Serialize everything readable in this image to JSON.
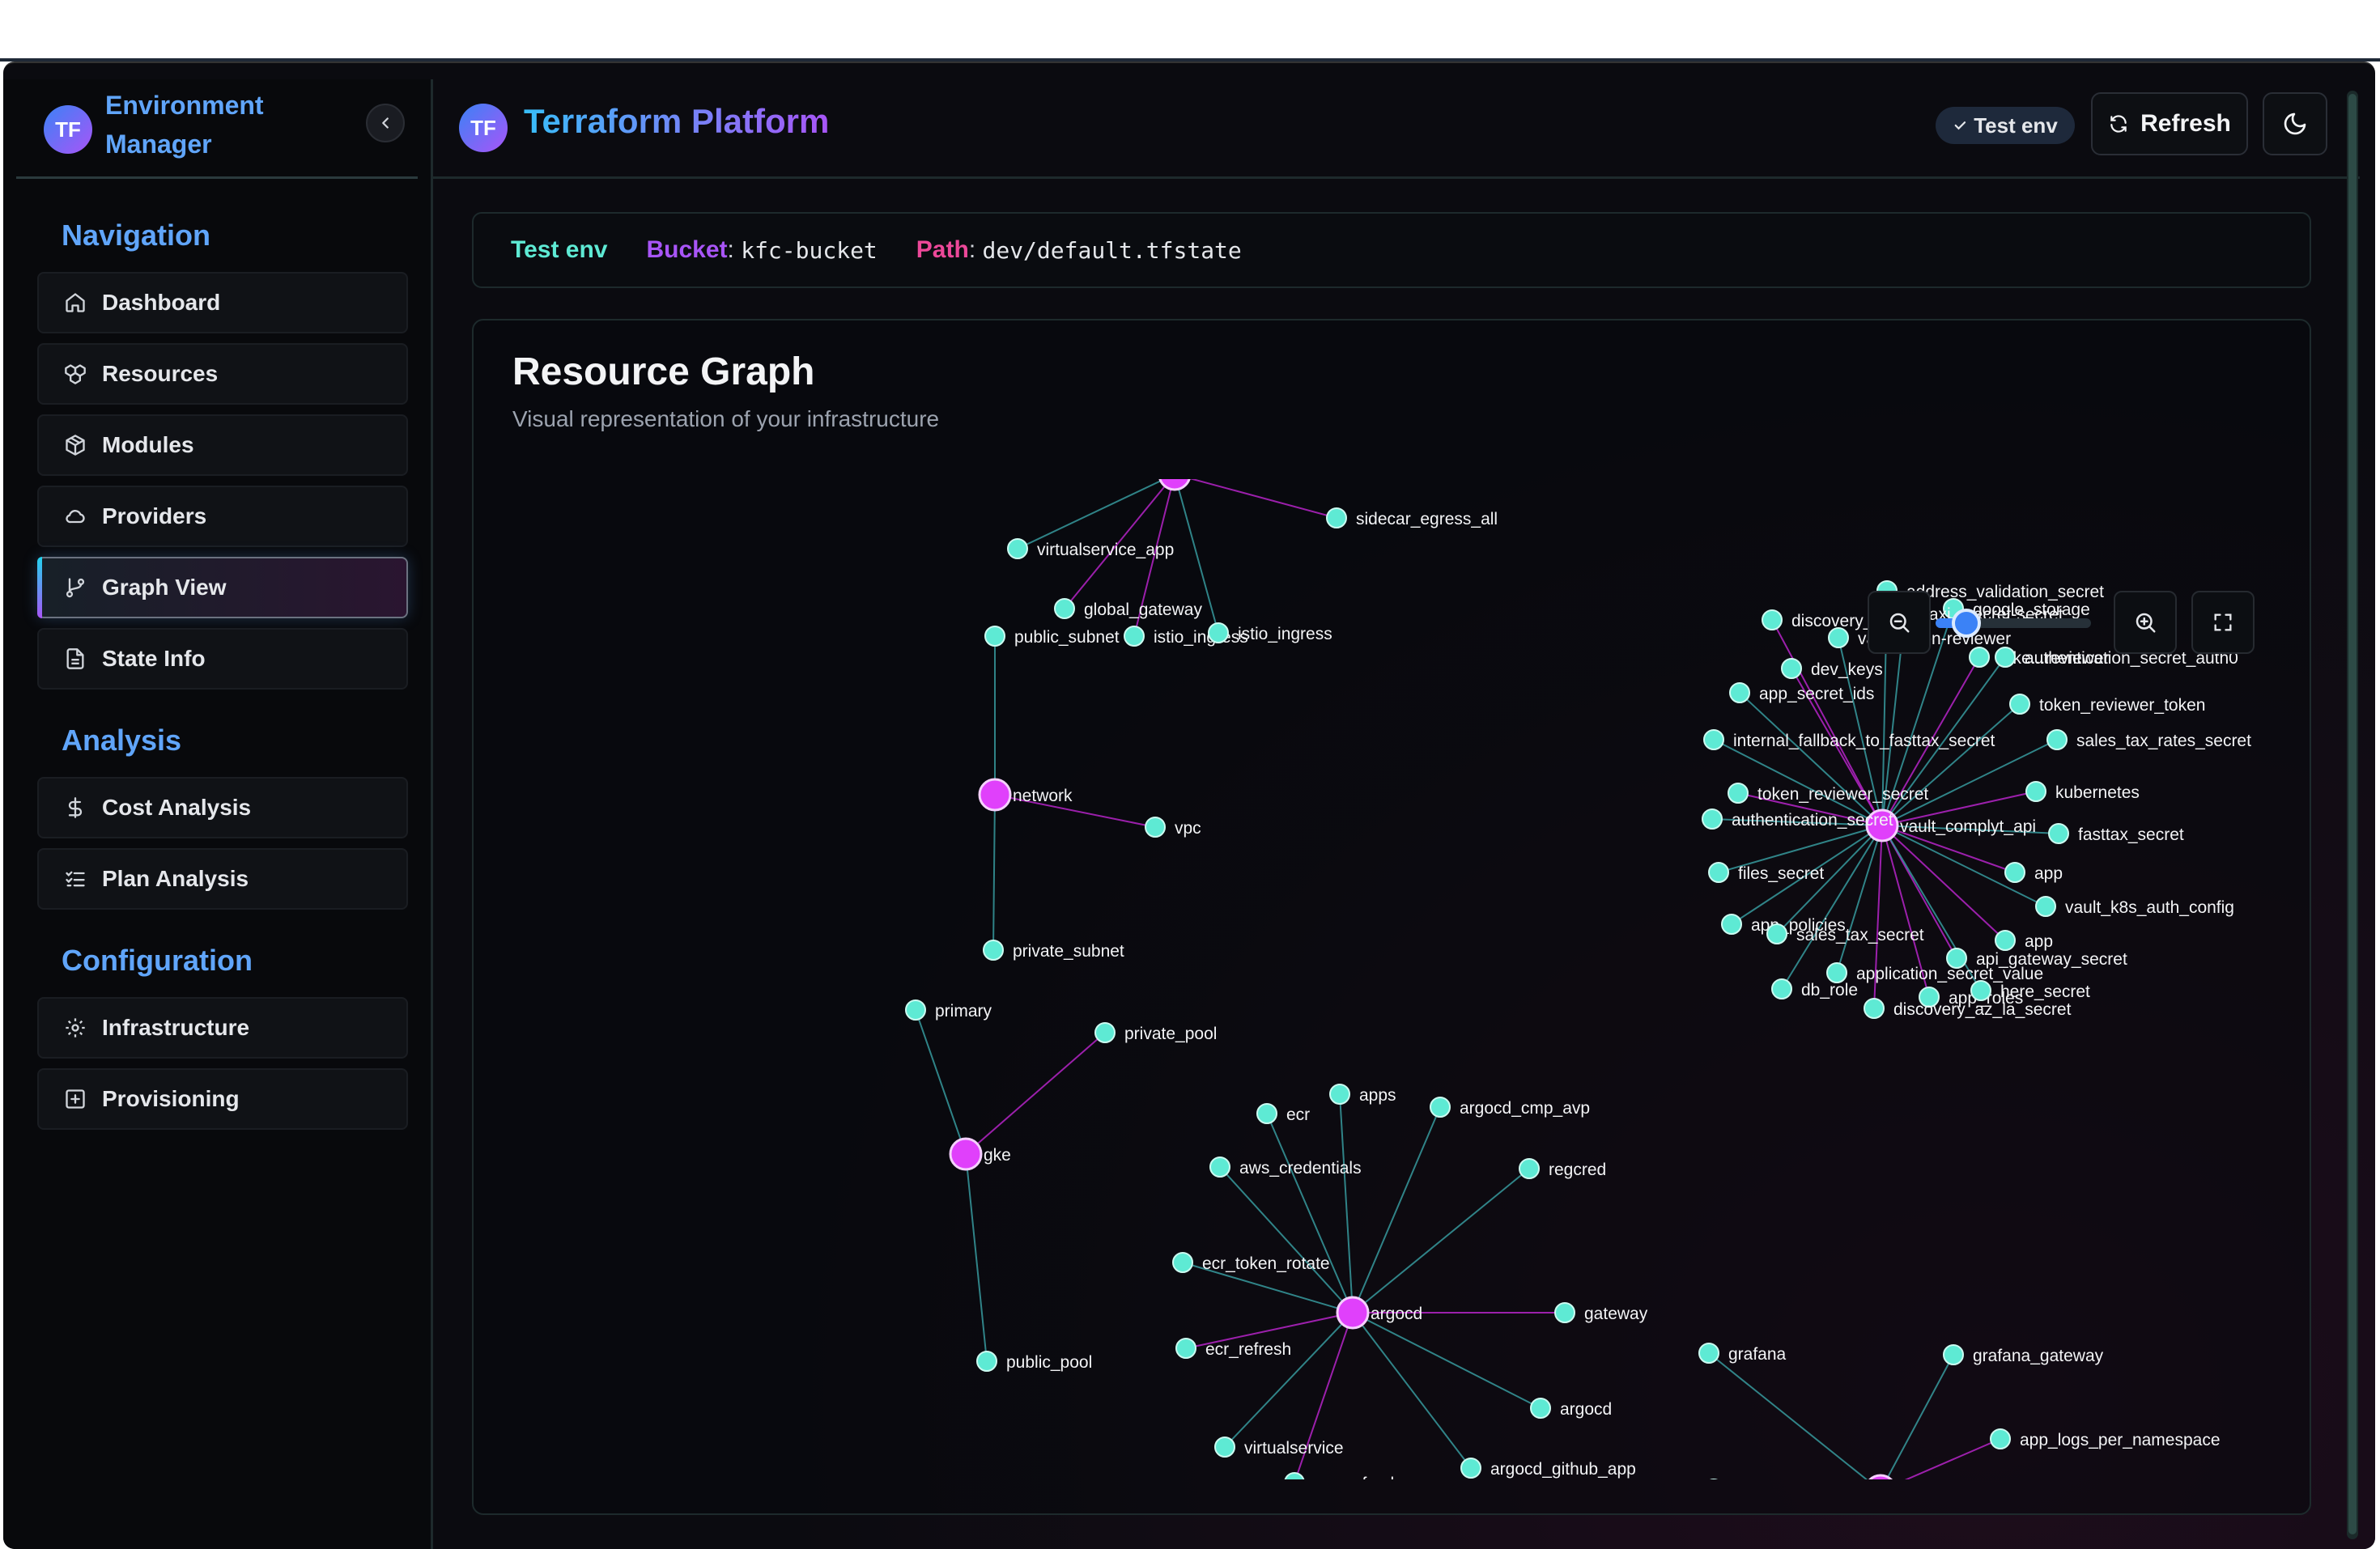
{
  "sidebar": {
    "avatar": "TF",
    "title": "Environment Manager",
    "sections": [
      {
        "title": "Navigation",
        "items": [
          {
            "label": "Dashboard",
            "icon": "home-icon"
          },
          {
            "label": "Resources",
            "icon": "boxes-icon"
          },
          {
            "label": "Modules",
            "icon": "package-icon"
          },
          {
            "label": "Providers",
            "icon": "cloud-icon"
          },
          {
            "label": "Graph View",
            "icon": "git-branch-icon",
            "active": true
          },
          {
            "label": "State Info",
            "icon": "file-text-icon"
          }
        ]
      },
      {
        "title": "Analysis",
        "items": [
          {
            "label": "Cost Analysis",
            "icon": "dollar-icon"
          },
          {
            "label": "Plan Analysis",
            "icon": "list-checks-icon"
          }
        ]
      },
      {
        "title": "Configuration",
        "items": [
          {
            "label": "Infrastructure",
            "icon": "gear-icon"
          },
          {
            "label": "Provisioning",
            "icon": "plus-square-icon"
          }
        ]
      }
    ]
  },
  "header": {
    "avatar": "TF",
    "title": "Terraform Platform",
    "env_badge": "Test env",
    "refresh_label": "Refresh"
  },
  "infobar": {
    "env": "Test env",
    "bucket_label": "Bucket",
    "bucket_value": "kfc-bucket",
    "path_label": "Path",
    "path_value": "dev/default.tfstate"
  },
  "graph_card": {
    "title": "Resource Graph",
    "subtitle": "Visual representation of your infrastructure",
    "zoom_level": 0.2
  },
  "colors": {
    "leaf_node": "#5eead4",
    "hub_node": "#e040fb",
    "link_cyan": "#3aa3a6",
    "link_pink": "#c026d3"
  },
  "graph": {
    "nodes": [
      {
        "id": "istio_hub",
        "label": "",
        "type": "hub"
      },
      {
        "id": "virtualservice_app",
        "label": "virtualservice_app"
      },
      {
        "id": "sidecar_egress_all",
        "label": "sidecar_egress_all"
      },
      {
        "id": "global_gateway",
        "label": "global_gateway"
      },
      {
        "id": "istio_ingress_1",
        "label": "istio_ingress"
      },
      {
        "id": "istio_ingress_2",
        "label": "istio_ingress"
      },
      {
        "id": "public_subnet",
        "label": "public_subnet"
      },
      {
        "id": "network",
        "label": "network",
        "type": "hub"
      },
      {
        "id": "vpc",
        "label": "vpc"
      },
      {
        "id": "private_subnet",
        "label": "private_subnet"
      },
      {
        "id": "primary",
        "label": "primary"
      },
      {
        "id": "private_pool",
        "label": "private_pool"
      },
      {
        "id": "gke",
        "label": "gke",
        "type": "hub"
      },
      {
        "id": "public_pool",
        "label": "public_pool"
      },
      {
        "id": "vault_complyt_api",
        "label": "vault_complyt_api",
        "type": "hub"
      },
      {
        "id": "address_validation_secret",
        "label": "address_validation_secret"
      },
      {
        "id": "google_storage",
        "label": "google_storage"
      },
      {
        "id": "discovery_az_secret",
        "label": "discovery_az_"
      },
      {
        "id": "taxjar_secret",
        "label": "taxj...secret-secret"
      },
      {
        "id": "vault_token_reviewer",
        "label": "vault-token-reviewer"
      },
      {
        "id": "token_reviewer",
        "label": "toke...reviewer"
      },
      {
        "id": "authentication_secret_auth0",
        "label": "authentication_secret_auth0"
      },
      {
        "id": "dev_keys",
        "label": "dev_keys"
      },
      {
        "id": "app_secret_ids",
        "label": "app_secret_ids"
      },
      {
        "id": "token_reviewer_token",
        "label": "token_reviewer_token"
      },
      {
        "id": "internal_fallback",
        "label": "internal_fallback_to_fasttax_secret"
      },
      {
        "id": "sales_tax_rates_secret",
        "label": "sales_tax_rates_secret"
      },
      {
        "id": "token_reviewer_secret",
        "label": "token_reviewer_secret"
      },
      {
        "id": "kubernetes",
        "label": "kubernetes"
      },
      {
        "id": "authentication_secret",
        "label": "authentication_secret"
      },
      {
        "id": "fasttax_secret",
        "label": "fasttax_secret"
      },
      {
        "id": "files_secret",
        "label": "files_secret"
      },
      {
        "id": "app_v",
        "label": "app"
      },
      {
        "id": "vault_k8s_auth_config",
        "label": "vault_k8s_auth_config"
      },
      {
        "id": "app_policies",
        "label": "app_policies"
      },
      {
        "id": "app_v2",
        "label": "app"
      },
      {
        "id": "sales_tax_secret",
        "label": "sales_tax_secret"
      },
      {
        "id": "api_gateway_secret",
        "label": "api_gateway_secret"
      },
      {
        "id": "application_secret_value",
        "label": "application_secret_value"
      },
      {
        "id": "db_role",
        "label": "db_role"
      },
      {
        "id": "app_roles",
        "label": "app_roles"
      },
      {
        "id": "here_secret",
        "label": "here_secret"
      },
      {
        "id": "discovery_az_la_secret",
        "label": "discovery_az_la_secret"
      },
      {
        "id": "argocd_hub",
        "label": "argocd",
        "type": "hub"
      },
      {
        "id": "apps",
        "label": "apps"
      },
      {
        "id": "ecr",
        "label": "ecr"
      },
      {
        "id": "argocd_cmp_avp",
        "label": "argocd_cmp_avp"
      },
      {
        "id": "aws_credentials",
        "label": "aws_credentials"
      },
      {
        "id": "regcred",
        "label": "regcred"
      },
      {
        "id": "ecr_token_rotate",
        "label": "ecr_token_rotate"
      },
      {
        "id": "gateway",
        "label": "gateway"
      },
      {
        "id": "ecr_refresh",
        "label": "ecr_refresh"
      },
      {
        "id": "argocd_leaf",
        "label": "argocd"
      },
      {
        "id": "virtualservice",
        "label": "virtualservice"
      },
      {
        "id": "argocd_github_app",
        "label": "argocd_github_app"
      },
      {
        "id": "ecr_refresh_2",
        "label": "ecr_refresh"
      },
      {
        "id": "grafana_hub",
        "label": "",
        "type": "hub"
      },
      {
        "id": "grafana",
        "label": "grafana"
      },
      {
        "id": "grafana_gateway",
        "label": "grafana_gateway"
      },
      {
        "id": "app_logs_per_namespace",
        "label": "app_logs_per_namespace"
      },
      {
        "id": "stub_node",
        "label": ""
      }
    ],
    "edges": [
      [
        "istio_hub",
        "virtualservice_app",
        "c"
      ],
      [
        "istio_hub",
        "sidecar_egress_all",
        "p"
      ],
      [
        "istio_hub",
        "global_gateway",
        "p"
      ],
      [
        "istio_hub",
        "istio_ingress_1",
        "p"
      ],
      [
        "istio_hub",
        "istio_ingress_2",
        "c"
      ],
      [
        "network",
        "public_subnet",
        "c"
      ],
      [
        "network",
        "vpc",
        "p"
      ],
      [
        "network",
        "private_subnet",
        "c"
      ],
      [
        "gke",
        "primary",
        "c"
      ],
      [
        "gke",
        "private_pool",
        "p"
      ],
      [
        "gke",
        "public_pool",
        "c"
      ],
      [
        "vault_complyt_api",
        "address_validation_secret",
        "c"
      ],
      [
        "vault_complyt_api",
        "google_storage",
        "c"
      ],
      [
        "vault_complyt_api",
        "discovery_az_secret",
        "p"
      ],
      [
        "vault_complyt_api",
        "taxjar_secret",
        "c"
      ],
      [
        "vault_complyt_api",
        "vault_token_reviewer",
        "c"
      ],
      [
        "vault_complyt_api",
        "token_reviewer",
        "p"
      ],
      [
        "vault_complyt_api",
        "authentication_secret_auth0",
        "c"
      ],
      [
        "vault_complyt_api",
        "dev_keys",
        "p"
      ],
      [
        "vault_complyt_api",
        "app_secret_ids",
        "c"
      ],
      [
        "vault_complyt_api",
        "token_reviewer_token",
        "c"
      ],
      [
        "vault_complyt_api",
        "internal_fallback",
        "c"
      ],
      [
        "vault_complyt_api",
        "sales_tax_rates_secret",
        "c"
      ],
      [
        "vault_complyt_api",
        "token_reviewer_secret",
        "p"
      ],
      [
        "vault_complyt_api",
        "kubernetes",
        "p"
      ],
      [
        "vault_complyt_api",
        "authentication_secret",
        "c"
      ],
      [
        "vault_complyt_api",
        "fasttax_secret",
        "c"
      ],
      [
        "vault_complyt_api",
        "files_secret",
        "c"
      ],
      [
        "vault_complyt_api",
        "app_v",
        "p"
      ],
      [
        "vault_complyt_api",
        "vault_k8s_auth_config",
        "c"
      ],
      [
        "vault_complyt_api",
        "app_policies",
        "c"
      ],
      [
        "vault_complyt_api",
        "app_v2",
        "p"
      ],
      [
        "vault_complyt_api",
        "sales_tax_secret",
        "c"
      ],
      [
        "vault_complyt_api",
        "api_gateway_secret",
        "p"
      ],
      [
        "vault_complyt_api",
        "application_secret_value",
        "c"
      ],
      [
        "vault_complyt_api",
        "db_role",
        "c"
      ],
      [
        "vault_complyt_api",
        "app_roles",
        "p"
      ],
      [
        "vault_complyt_api",
        "here_secret",
        "c"
      ],
      [
        "vault_complyt_api",
        "discovery_az_la_secret",
        "p"
      ],
      [
        "argocd_hub",
        "apps",
        "c"
      ],
      [
        "argocd_hub",
        "ecr",
        "c"
      ],
      [
        "argocd_hub",
        "argocd_cmp_avp",
        "c"
      ],
      [
        "argocd_hub",
        "aws_credentials",
        "c"
      ],
      [
        "argocd_hub",
        "regcred",
        "c"
      ],
      [
        "argocd_hub",
        "ecr_token_rotate",
        "c"
      ],
      [
        "argocd_hub",
        "gateway",
        "p"
      ],
      [
        "argocd_hub",
        "ecr_refresh",
        "p"
      ],
      [
        "argocd_hub",
        "argocd_leaf",
        "c"
      ],
      [
        "argocd_hub",
        "virtualservice",
        "c"
      ],
      [
        "argocd_hub",
        "argocd_github_app",
        "c"
      ],
      [
        "argocd_hub",
        "ecr_refresh_2",
        "p"
      ],
      [
        "grafana_hub",
        "grafana",
        "c"
      ],
      [
        "grafana_hub",
        "grafana_gateway",
        "c"
      ],
      [
        "grafana_hub",
        "app_logs_per_namespace",
        "p"
      ]
    ]
  }
}
